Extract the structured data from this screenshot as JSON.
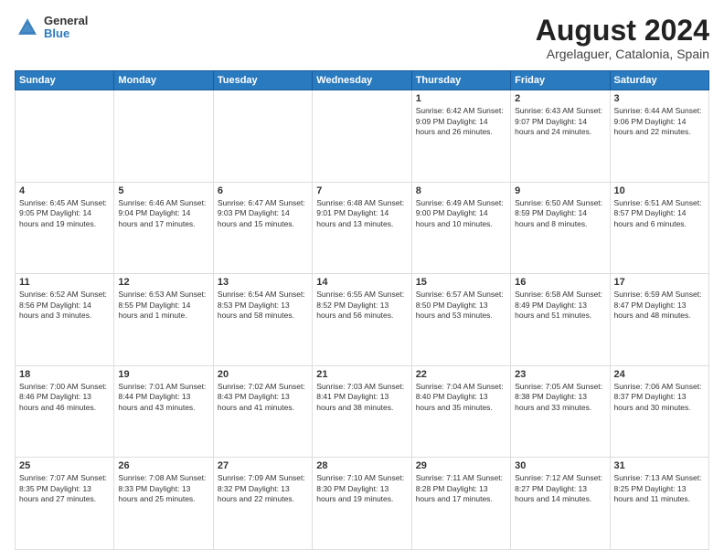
{
  "logo": {
    "general": "General",
    "blue": "Blue"
  },
  "title": "August 2024",
  "subtitle": "Argelaguer, Catalonia, Spain",
  "weekdays": [
    "Sunday",
    "Monday",
    "Tuesday",
    "Wednesday",
    "Thursday",
    "Friday",
    "Saturday"
  ],
  "weeks": [
    [
      {
        "day": "",
        "detail": ""
      },
      {
        "day": "",
        "detail": ""
      },
      {
        "day": "",
        "detail": ""
      },
      {
        "day": "",
        "detail": ""
      },
      {
        "day": "1",
        "detail": "Sunrise: 6:42 AM\nSunset: 9:09 PM\nDaylight: 14 hours\nand 26 minutes."
      },
      {
        "day": "2",
        "detail": "Sunrise: 6:43 AM\nSunset: 9:07 PM\nDaylight: 14 hours\nand 24 minutes."
      },
      {
        "day": "3",
        "detail": "Sunrise: 6:44 AM\nSunset: 9:06 PM\nDaylight: 14 hours\nand 22 minutes."
      }
    ],
    [
      {
        "day": "4",
        "detail": "Sunrise: 6:45 AM\nSunset: 9:05 PM\nDaylight: 14 hours\nand 19 minutes."
      },
      {
        "day": "5",
        "detail": "Sunrise: 6:46 AM\nSunset: 9:04 PM\nDaylight: 14 hours\nand 17 minutes."
      },
      {
        "day": "6",
        "detail": "Sunrise: 6:47 AM\nSunset: 9:03 PM\nDaylight: 14 hours\nand 15 minutes."
      },
      {
        "day": "7",
        "detail": "Sunrise: 6:48 AM\nSunset: 9:01 PM\nDaylight: 14 hours\nand 13 minutes."
      },
      {
        "day": "8",
        "detail": "Sunrise: 6:49 AM\nSunset: 9:00 PM\nDaylight: 14 hours\nand 10 minutes."
      },
      {
        "day": "9",
        "detail": "Sunrise: 6:50 AM\nSunset: 8:59 PM\nDaylight: 14 hours\nand 8 minutes."
      },
      {
        "day": "10",
        "detail": "Sunrise: 6:51 AM\nSunset: 8:57 PM\nDaylight: 14 hours\nand 6 minutes."
      }
    ],
    [
      {
        "day": "11",
        "detail": "Sunrise: 6:52 AM\nSunset: 8:56 PM\nDaylight: 14 hours\nand 3 minutes."
      },
      {
        "day": "12",
        "detail": "Sunrise: 6:53 AM\nSunset: 8:55 PM\nDaylight: 14 hours\nand 1 minute."
      },
      {
        "day": "13",
        "detail": "Sunrise: 6:54 AM\nSunset: 8:53 PM\nDaylight: 13 hours\nand 58 minutes."
      },
      {
        "day": "14",
        "detail": "Sunrise: 6:55 AM\nSunset: 8:52 PM\nDaylight: 13 hours\nand 56 minutes."
      },
      {
        "day": "15",
        "detail": "Sunrise: 6:57 AM\nSunset: 8:50 PM\nDaylight: 13 hours\nand 53 minutes."
      },
      {
        "day": "16",
        "detail": "Sunrise: 6:58 AM\nSunset: 8:49 PM\nDaylight: 13 hours\nand 51 minutes."
      },
      {
        "day": "17",
        "detail": "Sunrise: 6:59 AM\nSunset: 8:47 PM\nDaylight: 13 hours\nand 48 minutes."
      }
    ],
    [
      {
        "day": "18",
        "detail": "Sunrise: 7:00 AM\nSunset: 8:46 PM\nDaylight: 13 hours\nand 46 minutes."
      },
      {
        "day": "19",
        "detail": "Sunrise: 7:01 AM\nSunset: 8:44 PM\nDaylight: 13 hours\nand 43 minutes."
      },
      {
        "day": "20",
        "detail": "Sunrise: 7:02 AM\nSunset: 8:43 PM\nDaylight: 13 hours\nand 41 minutes."
      },
      {
        "day": "21",
        "detail": "Sunrise: 7:03 AM\nSunset: 8:41 PM\nDaylight: 13 hours\nand 38 minutes."
      },
      {
        "day": "22",
        "detail": "Sunrise: 7:04 AM\nSunset: 8:40 PM\nDaylight: 13 hours\nand 35 minutes."
      },
      {
        "day": "23",
        "detail": "Sunrise: 7:05 AM\nSunset: 8:38 PM\nDaylight: 13 hours\nand 33 minutes."
      },
      {
        "day": "24",
        "detail": "Sunrise: 7:06 AM\nSunset: 8:37 PM\nDaylight: 13 hours\nand 30 minutes."
      }
    ],
    [
      {
        "day": "25",
        "detail": "Sunrise: 7:07 AM\nSunset: 8:35 PM\nDaylight: 13 hours\nand 27 minutes."
      },
      {
        "day": "26",
        "detail": "Sunrise: 7:08 AM\nSunset: 8:33 PM\nDaylight: 13 hours\nand 25 minutes."
      },
      {
        "day": "27",
        "detail": "Sunrise: 7:09 AM\nSunset: 8:32 PM\nDaylight: 13 hours\nand 22 minutes."
      },
      {
        "day": "28",
        "detail": "Sunrise: 7:10 AM\nSunset: 8:30 PM\nDaylight: 13 hours\nand 19 minutes."
      },
      {
        "day": "29",
        "detail": "Sunrise: 7:11 AM\nSunset: 8:28 PM\nDaylight: 13 hours\nand 17 minutes."
      },
      {
        "day": "30",
        "detail": "Sunrise: 7:12 AM\nSunset: 8:27 PM\nDaylight: 13 hours\nand 14 minutes."
      },
      {
        "day": "31",
        "detail": "Sunrise: 7:13 AM\nSunset: 8:25 PM\nDaylight: 13 hours\nand 11 minutes."
      }
    ]
  ]
}
